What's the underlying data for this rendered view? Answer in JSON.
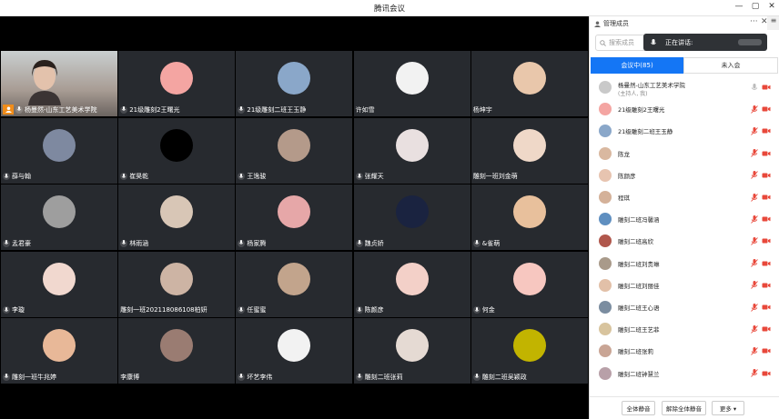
{
  "window": {
    "title": "腾讯会议",
    "minimize": "—",
    "maximize": "▢",
    "close": "✕"
  },
  "self_tile": {
    "name": "杨曼然-山东工艺美术学院"
  },
  "tiles": [
    {
      "name": "21级雕刻2王曙光",
      "mic": true
    },
    {
      "name": "21级雕刻二班王玉静",
      "mic": true
    },
    {
      "name": "许如雪",
      "mic": false
    },
    {
      "name": "杨坤宇",
      "mic": false
    },
    {
      "name": "薛与翰",
      "mic": true
    },
    {
      "name": "崔昊乾",
      "mic": true
    },
    {
      "name": "王逸骏",
      "mic": true
    },
    {
      "name": "张耀天",
      "mic": true
    },
    {
      "name": "雕刻一班刘金萌",
      "mic": false
    },
    {
      "name": "孟君豪",
      "mic": true
    },
    {
      "name": "林雨涵",
      "mic": true
    },
    {
      "name": "杨家腾",
      "mic": true
    },
    {
      "name": "魏贞娇",
      "mic": true
    },
    {
      "name": "&雀萌",
      "mic": true
    },
    {
      "name": "李璇",
      "mic": true
    },
    {
      "name": "雕刻一班202118086108柏妍",
      "mic": false
    },
    {
      "name": "任蜜蜜",
      "mic": true
    },
    {
      "name": "陈颜彦",
      "mic": true
    },
    {
      "name": "何金",
      "mic": true
    },
    {
      "name": "雕刻一班牛兆婷",
      "mic": true
    },
    {
      "name": "李康博",
      "mic": false
    },
    {
      "name": "坏艺李伟",
      "mic": true
    },
    {
      "name": "雕刻二班张莉",
      "mic": true
    },
    {
      "name": "雕刻二班吴颖政",
      "mic": true
    }
  ],
  "panel": {
    "title": "管理成员",
    "more": "···",
    "close": "✕",
    "side": "≡",
    "search_placeholder": "搜索成员",
    "speaking_label": "正在讲话:",
    "tab_in_meeting": "会议中(85)",
    "tab_not_joined": "未入会",
    "members": [
      {
        "name": "杨曼然-山东工艺美术学院",
        "sub": "(主持人, 我)",
        "muted": false
      },
      {
        "name": "21级雕刻2王曙光",
        "muted": true
      },
      {
        "name": "21级雕刻二班王玉静",
        "muted": true
      },
      {
        "name": "陈龙",
        "muted": true
      },
      {
        "name": "陈颜彦",
        "muted": true
      },
      {
        "name": "程琪",
        "muted": true
      },
      {
        "name": "雕刻二班冯馨涵",
        "muted": true
      },
      {
        "name": "雕刻二班高欣",
        "muted": true
      },
      {
        "name": "雕刻二班刘贵琳",
        "muted": true
      },
      {
        "name": "雕刻二班刘丽佳",
        "muted": true
      },
      {
        "name": "雕刻二班王心语",
        "muted": true
      },
      {
        "name": "雕刻二班王艺菲",
        "muted": true
      },
      {
        "name": "雕刻二班张莉",
        "muted": true
      },
      {
        "name": "雕刻二班钟慧兰",
        "muted": true
      }
    ],
    "mute_all": "全体静音",
    "unmute_all": "解除全体静音",
    "more_btn": "更多 ▾"
  },
  "colors": {
    "accent": "#1476f5",
    "host_badge": "#f08c1a",
    "muted_icon": "#e8483b",
    "tile_bg": "#272a2f"
  }
}
